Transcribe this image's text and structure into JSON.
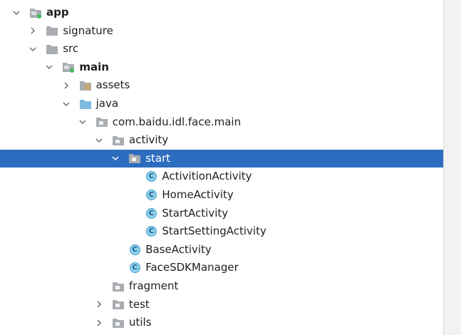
{
  "project_tree": {
    "nodes": [
      {
        "label": "app",
        "depth": 0,
        "expanded": true,
        "icon": "module-folder-icon",
        "bold": true,
        "selected": false
      },
      {
        "label": "signature",
        "depth": 1,
        "expanded": false,
        "icon": "folder-icon",
        "bold": false,
        "selected": false
      },
      {
        "label": "src",
        "depth": 1,
        "expanded": true,
        "icon": "folder-icon",
        "bold": false,
        "selected": false
      },
      {
        "label": "main",
        "depth": 2,
        "expanded": true,
        "icon": "source-set-folder-icon",
        "bold": true,
        "selected": false
      },
      {
        "label": "assets",
        "depth": 3,
        "expanded": false,
        "icon": "assets-folder-icon",
        "bold": false,
        "selected": false
      },
      {
        "label": "java",
        "depth": 3,
        "expanded": true,
        "icon": "source-root-folder-icon",
        "bold": false,
        "selected": false
      },
      {
        "label": "com.baidu.idl.face.main",
        "depth": 4,
        "expanded": true,
        "icon": "package-icon",
        "bold": false,
        "selected": false
      },
      {
        "label": "activity",
        "depth": 5,
        "expanded": true,
        "icon": "package-icon",
        "bold": false,
        "selected": false
      },
      {
        "label": "start",
        "depth": 6,
        "expanded": true,
        "icon": "package-icon",
        "bold": false,
        "selected": true
      },
      {
        "label": "ActivitionActivity",
        "depth": 7,
        "expanded": null,
        "icon": "class-icon",
        "bold": false,
        "selected": false
      },
      {
        "label": "HomeActivity",
        "depth": 7,
        "expanded": null,
        "icon": "class-icon",
        "bold": false,
        "selected": false
      },
      {
        "label": "StartActivity",
        "depth": 7,
        "expanded": null,
        "icon": "class-icon",
        "bold": false,
        "selected": false
      },
      {
        "label": "StartSettingActivity",
        "depth": 7,
        "expanded": null,
        "icon": "class-icon",
        "bold": false,
        "selected": false
      },
      {
        "label": "BaseActivity",
        "depth": 6,
        "expanded": null,
        "icon": "class-icon",
        "bold": false,
        "selected": false
      },
      {
        "label": "FaceSDKManager",
        "depth": 6,
        "expanded": null,
        "icon": "class-icon",
        "bold": false,
        "selected": false
      },
      {
        "label": "fragment",
        "depth": 5,
        "expanded": null,
        "icon": "package-icon",
        "bold": false,
        "selected": false
      },
      {
        "label": "test",
        "depth": 5,
        "expanded": false,
        "icon": "package-icon",
        "bold": false,
        "selected": false
      },
      {
        "label": "utils",
        "depth": 5,
        "expanded": false,
        "icon": "package-icon",
        "bold": false,
        "selected": false
      }
    ]
  },
  "colors": {
    "selection": "#2d6dc0",
    "folder": "#a9adb2",
    "source_root": "#7fb9de",
    "class_icon_fill": "#8ed0ec",
    "module_dot": "#3fbf5a",
    "assets_stripes": "#d9a441"
  },
  "class_glyph": "C"
}
